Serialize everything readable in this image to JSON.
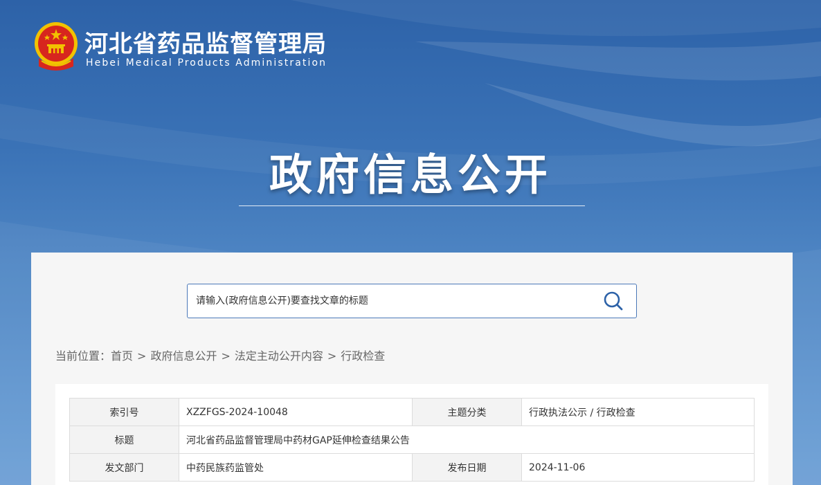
{
  "header": {
    "title_cn": "河北省药品监督管理局",
    "title_en": "Hebei Medical Products Administration"
  },
  "hero": {
    "title": "政府信息公开"
  },
  "search": {
    "placeholder": "请输入(政府信息公开)要查找文章的标题"
  },
  "breadcrumb": {
    "prefix": "当前位置：",
    "items": [
      "首页",
      "政府信息公开",
      "法定主动公开内容",
      "行政检查"
    ],
    "separator": ">"
  },
  "meta_table": {
    "index_no_label": "索引号",
    "index_no_value": "XZZFGS-2024-10048",
    "category_label": "主题分类",
    "category_value": "行政执法公示 / 行政检查",
    "title_label": "标题",
    "title_value": "河北省药品监督管理局中药材GAP延伸检查结果公告",
    "department_label": "发文部门",
    "department_value": "中药民族药监管处",
    "date_label": "发布日期",
    "date_value": "2024-11-06"
  },
  "colors": {
    "primary_blue": "#2d62a8",
    "emblem_red": "#d7261e",
    "emblem_gold": "#f2c200",
    "border_blue": "#4a78b8"
  },
  "icons": {
    "search_button": "search-icon",
    "emblem": "national-emblem-icon"
  }
}
